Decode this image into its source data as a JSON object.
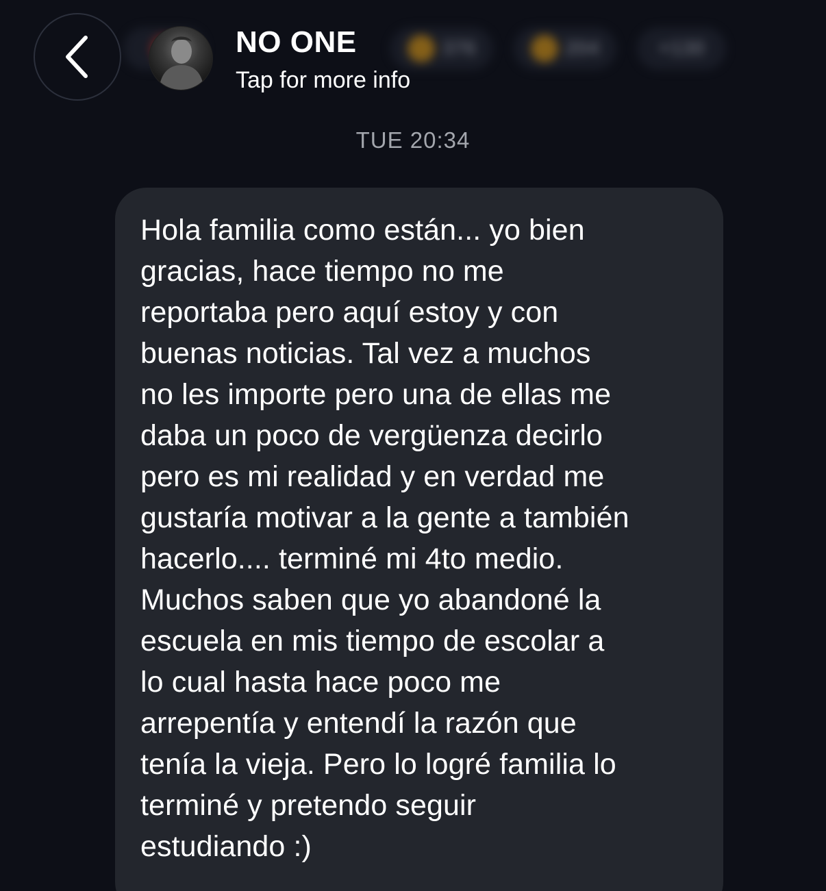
{
  "header": {
    "contact_name": "NO ONE",
    "subtitle": "Tap for more info",
    "reactions": [
      {
        "icon": "thumbs-up-icon",
        "count": "376"
      },
      {
        "icon": "laughing-face-icon",
        "count": "204"
      },
      {
        "icon": "more-reactions-icon",
        "count": "+130"
      }
    ]
  },
  "conversation": {
    "timestamp": "TUE 20:34",
    "message": {
      "text": "Hola familia como están... yo bien\ngracias, hace tiempo no me\nreportaba pero aquí estoy y con\nbuenas noticias.  Tal vez a muchos\nno les importe pero una de ellas me\ndaba un poco de vergüenza decirlo\npero es mi realidad y en verdad me\ngustaría motivar a la gente a también\nhacerlo.... terminé mi 4to medio.\nMuchos saben que yo abandoné la\nescuela en mis tiempo de escolar a\nlo cual hasta hace poco me\narrepentía y entendí la razón que\ntenía la vieja. Pero lo logré familia lo\nterminé y pretendo seguir\nestudiando :)"
    }
  },
  "colors": {
    "background": "#0d0f17",
    "bubble": "#23262d",
    "timestamp": "#a3a6ad",
    "text": "#ffffff"
  }
}
